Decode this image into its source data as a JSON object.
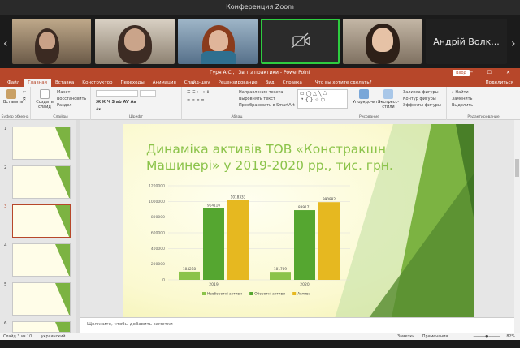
{
  "zoom": {
    "window_title": "Конференция Zoom",
    "participant_name": "Андрій Волк..."
  },
  "ppt": {
    "window_title": "Гуря А.С., _Звіт з практики - PowerPoint",
    "signin_label": "Вход",
    "tabs": [
      "Файл",
      "Главная",
      "Вставка",
      "Конструктор",
      "Переходы",
      "Анимация",
      "Слайд-шоу",
      "Рецензирование",
      "Вид",
      "Справка"
    ],
    "search_placeholder": "Что вы хотите сделать?",
    "share_label": "Поделиться",
    "ribbon": {
      "paste": "Вставить",
      "create_slide": "Создать слайд",
      "layout": "Макет",
      "reset": "Восстановить",
      "section": "Раздел",
      "arrange": "Упорядочить",
      "quick_styles": "Экспресс-стили",
      "shape_fill": "Заливка фигуры",
      "shape_outline": "Контур фигуры",
      "shape_effects": "Эффекты фигуры",
      "find": "Найти",
      "replace": "Заменить",
      "select": "Выделить",
      "text_direction": "Направление текста",
      "align_text": "Выровнять текст",
      "smartart": "Преобразовать в SmartArt",
      "groups": [
        "Буфер обмена",
        "Слайды",
        "Шрифт",
        "Абзац",
        "Рисование",
        "Редактирование"
      ]
    },
    "thumb_numbers": [
      "1",
      "2",
      "3",
      "4",
      "5",
      "6"
    ],
    "notes_placeholder": "Щелкните, чтобы добавить заметки",
    "status": {
      "slide_info": "Слайд 3 из 10",
      "language": "украинский",
      "notes_btn": "Заметки",
      "comments_btn": "Примечания",
      "zoom": "82%"
    }
  },
  "slide": {
    "title": "Динаміка активів ТОВ «Констракшн Машинері» у 2019-2020 рр., тис. грн."
  },
  "chart_data": {
    "type": "bar",
    "categories": [
      "2019",
      "2020"
    ],
    "series": [
      {
        "name": "Необоротні активи",
        "values": [
          104218,
          101709
        ],
        "color": "#8bc34a"
      },
      {
        "name": "Оборотні активи",
        "values": [
          914116,
          889171
        ],
        "color": "#55a630"
      },
      {
        "name": "Активи",
        "values": [
          1018333,
          990882
        ],
        "color": "#e6b820"
      }
    ],
    "ylim": [
      0,
      1200000
    ],
    "yticks": [
      "0",
      "200000",
      "400000",
      "600000",
      "800000",
      "1000000",
      "1200000"
    ],
    "data_labels": [
      [
        "104218",
        "914116",
        "1018333"
      ],
      [
        "101709",
        "889171",
        "990882"
      ]
    ],
    "legend_position": "bottom"
  }
}
